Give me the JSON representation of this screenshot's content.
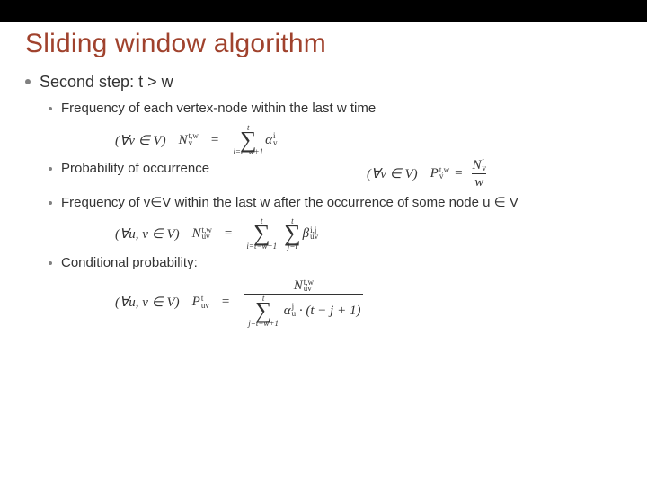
{
  "title": "Sliding window algorithm",
  "step": {
    "label": "Second step: t > w"
  },
  "bullets": {
    "freq_vertex": "Frequency of each vertex-node within the last w time",
    "prob_occ": "Probability of occurrence",
    "freq_pair": "Frequency of v∈V within the last w after the occurrence of some node u ∈ V",
    "cond_prob": "Conditional probability:"
  },
  "formulas": {
    "f1_lhs_quant": "(∀v ∈ V)",
    "f1_N": "N",
    "f1_N_sub": "v",
    "f1_N_sup": "t,w",
    "f1_eq": "=",
    "f1_sig_top": "t",
    "f1_sig_bot": "i=t−w+1",
    "f1_alpha": "α",
    "f1_alpha_sub": "v",
    "f1_alpha_sup": "i",
    "f2_lhs_quant": "(∀v ∈ V)",
    "f2_P": "P",
    "f2_P_sub": "v",
    "f2_P_sup": "t,w",
    "f2_eq": "=",
    "f2_num_N": "N",
    "f2_num_sub": "v",
    "f2_num_sup": "t",
    "f2_den": "w",
    "f3_lhs_quant": "(∀u, v ∈ V)",
    "f3_N": "N",
    "f3_N_sub": "uv",
    "f3_N_sup": "t,w",
    "f3_eq": "=",
    "f3_sig1_top": "t",
    "f3_sig1_bot": "i=t−w+1",
    "f3_sig2_top": "t",
    "f3_sig2_bot": "j=i",
    "f3_beta": "β",
    "f3_beta_sub": "uv",
    "f3_beta_sup": "i,j",
    "f4_lhs_quant": "(∀u, v ∈ V)",
    "f4_P": "P",
    "f4_P_sub": "uv",
    "f4_P_sup": "t",
    "f4_eq": "=",
    "f4_num_N": "N",
    "f4_num_sub": "uv",
    "f4_num_sup": "t,w",
    "f4_den_sig_top": "t",
    "f4_den_sig_bot": "j=t−w+1",
    "f4_den_alpha": "α",
    "f4_den_alpha_sub": "u",
    "f4_den_alpha_sup": "j",
    "f4_den_tail": " · (t − j + 1)"
  }
}
